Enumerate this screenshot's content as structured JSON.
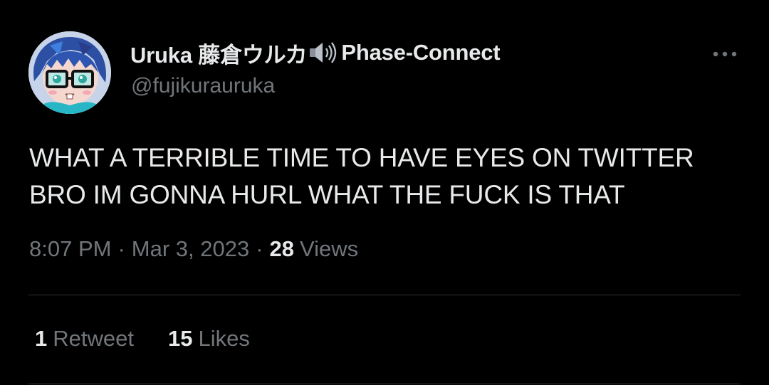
{
  "tweet": {
    "author": {
      "display_name": "Uruka 藤倉ウルカ",
      "display_name_suffix": "Phase-Connect",
      "handle": "@fujikurauruka",
      "avatar_icon": "vtuber-avatar",
      "speaker_icon": "speaker-volume-icon"
    },
    "text_lines": [
      "WHAT A TERRIBLE TIME TO HAVE EYES ON TWITTER",
      "BRO IM GONNA HURL WHAT THE FUCK IS THAT"
    ],
    "time": "8:07 PM",
    "separator": "·",
    "date": "Mar 3, 2023",
    "views_count": "28",
    "views_label": "Views",
    "retweets_count": "1",
    "retweets_label": "Retweet",
    "likes_count": "15",
    "likes_label": "Likes"
  },
  "colors": {
    "background": "#000000",
    "primary_text": "#e7e9ea",
    "secondary_text": "#71767b",
    "divider": "#2f3336"
  }
}
